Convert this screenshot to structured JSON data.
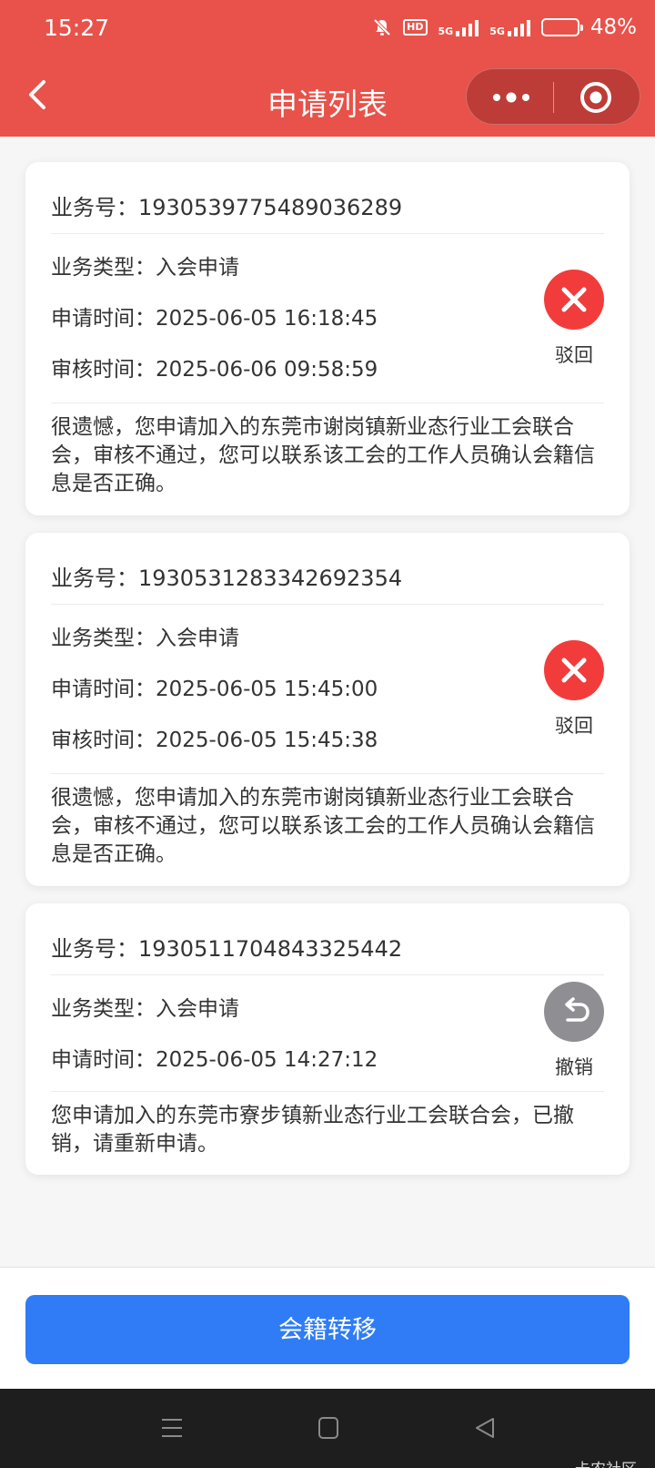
{
  "status_bar": {
    "time": "15:27",
    "network_5g": "5G",
    "network_5g_2": "5G",
    "hd_badge": "HD",
    "battery_percent": "48%",
    "battery_level": 0.48
  },
  "navbar": {
    "title": "申请列表",
    "back_icon": "chevron-left-icon",
    "more_icon": "more-dots-icon",
    "target_icon": "target-icon"
  },
  "applications": [
    {
      "business_no": "业务号：1930539775489036289",
      "type": "业务类型：入会申请",
      "apply_time": "申请时间：2025-06-05 16:18:45",
      "review_time": "审核时间：2025-06-06 09:58:59",
      "status_label": "驳回",
      "status_icon": "close-x-icon",
      "status_color": "#f23c3c",
      "message": "很遗憾，您申请加入的东莞市谢岗镇新业态行业工会联合会，审核不通过，您可以联系该工会的工作人员确认会籍信息是否正确。"
    },
    {
      "business_no": "业务号：1930531283342692354",
      "type": "业务类型：入会申请",
      "apply_time": "申请时间：2025-06-05 15:45:00",
      "review_time": "审核时间：2025-06-05 15:45:38",
      "status_label": "驳回",
      "status_icon": "close-x-icon",
      "status_color": "#f23c3c",
      "message": "很遗憾，您申请加入的东莞市谢岗镇新业态行业工会联合会，审核不通过，您可以联系该工会的工作人员确认会籍信息是否正确。"
    },
    {
      "business_no": "业务号：1930511704843325442",
      "type": "业务类型：入会申请",
      "apply_time": "申请时间：2025-06-05 14:27:12",
      "status_label": "撤销",
      "status_icon": "undo-arrow-icon",
      "status_color": "#8e8e93",
      "message": "您申请加入的东莞市寮步镇新业态行业工会联合会，已撤销，请重新申请。"
    }
  ],
  "bottom": {
    "button_label": "会籍转移",
    "button_color": "#2f7cf6"
  },
  "watermark": "卡农社区"
}
